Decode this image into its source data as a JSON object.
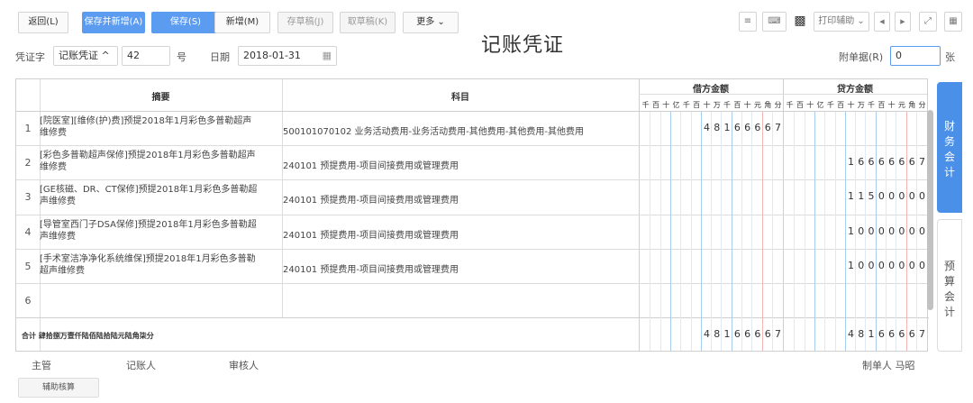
{
  "toolbar": {
    "back_label": "返回(L)",
    "save_new_label": "保存并新增(A)",
    "save_label": "保存(S)",
    "new_label": "新增(M)",
    "save_draft_label": "存草稿(J)",
    "take_draft_label": "取草稿(K)",
    "more_label": "更多 ⌄",
    "print_assist_label": "打印辅助 ⌄"
  },
  "page_title": "记账凭证",
  "voucher": {
    "word_label": "凭证字",
    "word_value": "记账凭证 ^",
    "number_value": "42",
    "number_suffix": "号",
    "date_label": "日期",
    "date_value": "2018-01-31",
    "attachments_label": "附单据(R)",
    "attachments_value": "0",
    "attachments_suffix": "张"
  },
  "table": {
    "col_summary": "摘要",
    "col_subject": "科目",
    "col_debit": "借方金额",
    "col_credit": "贷方金额",
    "units": [
      "千",
      "百",
      "十",
      "亿",
      "千",
      "百",
      "十",
      "万",
      "千",
      "百",
      "十",
      "元",
      "角",
      "分"
    ],
    "rows": [
      {
        "num": "1",
        "summary": "[院医室][维修(护)费]预提2018年1月彩色多普勒超声维修费",
        "subject": "500101070102 业务活动费用-业务活动费用-其他费用-其他费用-其他费用",
        "debit": "48166667",
        "credit": ""
      },
      {
        "num": "2",
        "summary": "[彩色多普勒超声保修]预提2018年1月彩色多普勒超声维修费",
        "subject": "240101 预提费用-项目间接费用或管理费用",
        "debit": "",
        "credit": "16666667"
      },
      {
        "num": "3",
        "summary": "[GE核磁、DR、CT保修]预提2018年1月彩色多普勒超声维修费",
        "subject": "240101 预提费用-项目间接费用或管理费用",
        "debit": "",
        "credit": "11500000"
      },
      {
        "num": "4",
        "summary": "[导管室西门子DSA保修]预提2018年1月彩色多普勒超声维修费",
        "subject": "240101 预提费用-项目间接费用或管理费用",
        "debit": "",
        "credit": "10000000"
      },
      {
        "num": "5",
        "summary": "[手术室洁净净化系统维保]预提2018年1月彩色多普勒超声维修费",
        "subject": "240101 预提费用-项目间接费用或管理费用",
        "debit": "",
        "credit": "10000000"
      },
      {
        "num": "6",
        "summary": "",
        "subject": "",
        "debit": "",
        "credit": ""
      }
    ],
    "total_label": "合计  肆拾捌万壹仟陆佰陆拾陆元陆角柒分",
    "total_debit": "48166667",
    "total_credit": "48166667"
  },
  "side_tabs": {
    "financial": "财务会计",
    "budget": "预算会计"
  },
  "signatures": {
    "supervisor": "主管",
    "bookkeeper": "记账人",
    "auditor": "审核人",
    "preparer": "制单人 马昭"
  },
  "assist_button_label": "辅助核算",
  "colors": {
    "accent": "#5b9bf0",
    "tab_active": "#4a8fe8"
  }
}
